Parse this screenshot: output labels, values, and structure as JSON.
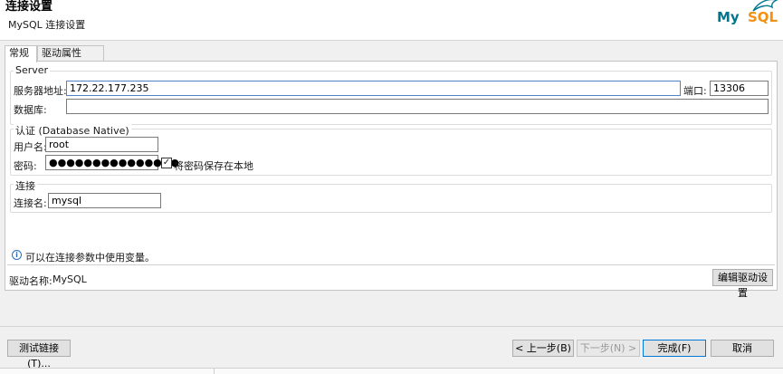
{
  "header": {
    "title": "连接设置",
    "subtitle": "MySQL 连接设置",
    "logo": {
      "part1": "My",
      "part2": "SQL",
      "icon": "dolphin-icon"
    }
  },
  "tabs": [
    {
      "label": "常规",
      "active": true
    },
    {
      "label": "驱动属性",
      "active": false
    }
  ],
  "server": {
    "legend": "Server",
    "host_label": "服务器地址:",
    "host_value": "172.22.177.235",
    "port_label": "端口:",
    "port_value": "13306",
    "db_label": "数据库:",
    "db_value": ""
  },
  "auth": {
    "legend": "认证 (Database Native)",
    "user_label": "用户名:",
    "user_value": "root",
    "password_label": "密码:",
    "password_value": "●●●●●●●●●●●●●●●",
    "save_password_label": "将密码保存在本地",
    "save_password_checked": true
  },
  "connection": {
    "legend": "连接",
    "name_label": "连接名:",
    "name_value": "mysql"
  },
  "info": {
    "icon": "info-icon",
    "text": "可以在连接参数中使用变量。"
  },
  "driver": {
    "label": "驱动名称:",
    "value": "MySQL",
    "edit_button": "编辑驱动设置"
  },
  "footer": {
    "test_button": "测试链接(T)...",
    "back_button": "< 上一步(B)",
    "next_button": "下一步(N) >",
    "finish_button": "完成(F)",
    "cancel_button": "取消"
  },
  "colors": {
    "focus_border": "#4f84c4",
    "mysql_blue": "#00758f",
    "mysql_orange": "#f29111",
    "info_blue": "#2a6fb8"
  }
}
